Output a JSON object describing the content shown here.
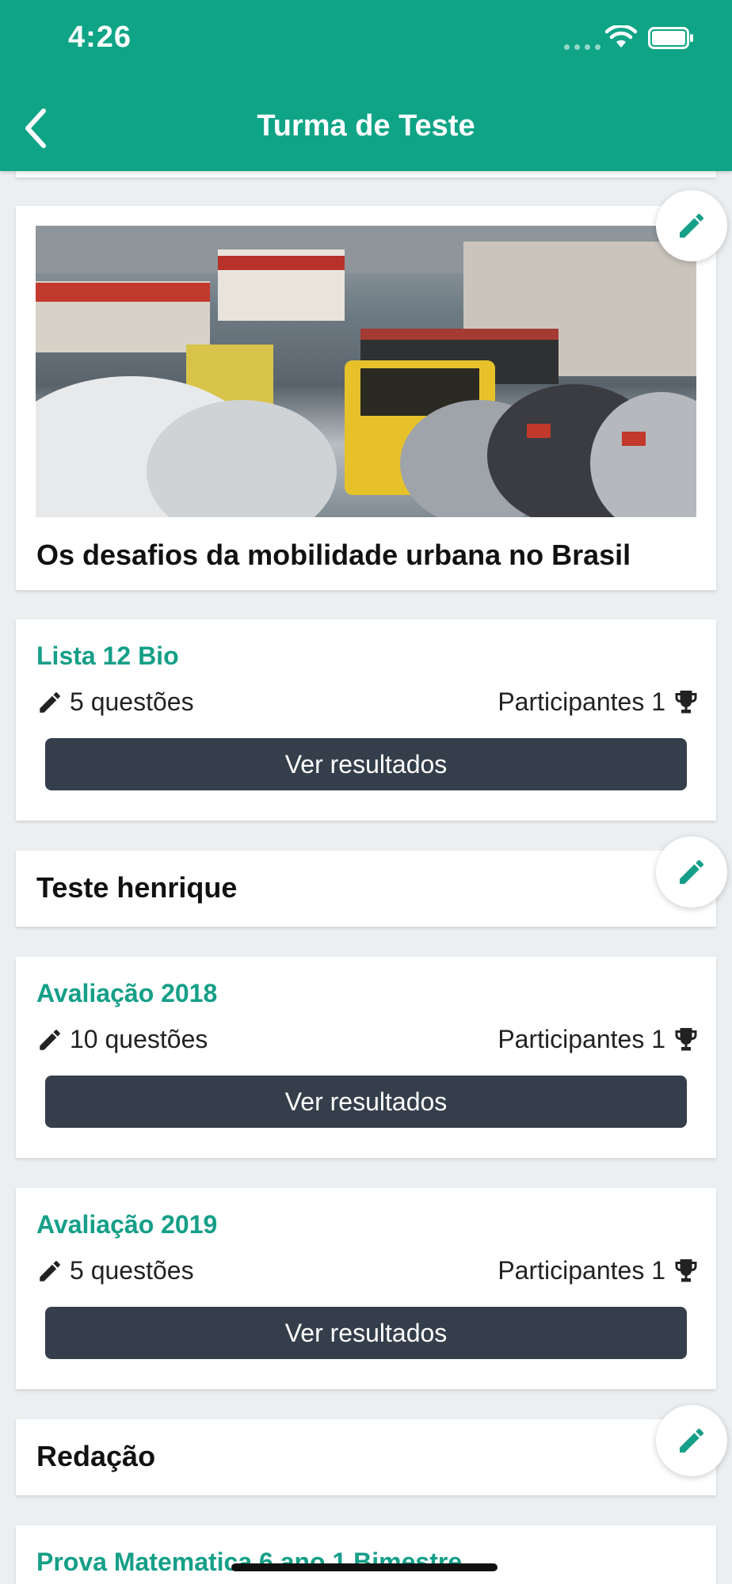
{
  "status_bar": {
    "time": "4:26"
  },
  "header": {
    "title": "Turma de Teste",
    "accent_color": "#0fa486"
  },
  "news": {
    "title": "Os desafios da mobilidade urbana no Brasil",
    "image": "traffic-photo"
  },
  "quizzes": [
    {
      "title": "Lista 12 Bio",
      "questions": "5 questões",
      "participants": "Participantes 1",
      "button": "Ver resultados"
    },
    {
      "title": "Avaliação 2018",
      "questions": "10 questões",
      "participants": "Participantes 1",
      "button": "Ver resultados"
    },
    {
      "title": "Avaliação 2019",
      "questions": "5 questões",
      "participants": "Participantes 1",
      "button": "Ver resultados"
    }
  ],
  "sections": [
    {
      "title": "Teste henrique"
    },
    {
      "title": "Redação"
    }
  ],
  "partial_item": {
    "title": "Prova Matematica 6 ano 1 Bimestre"
  },
  "icons": [
    "chevron-left-icon",
    "pencil-icon",
    "trophy-icon",
    "wifi-icon",
    "battery-icon"
  ]
}
